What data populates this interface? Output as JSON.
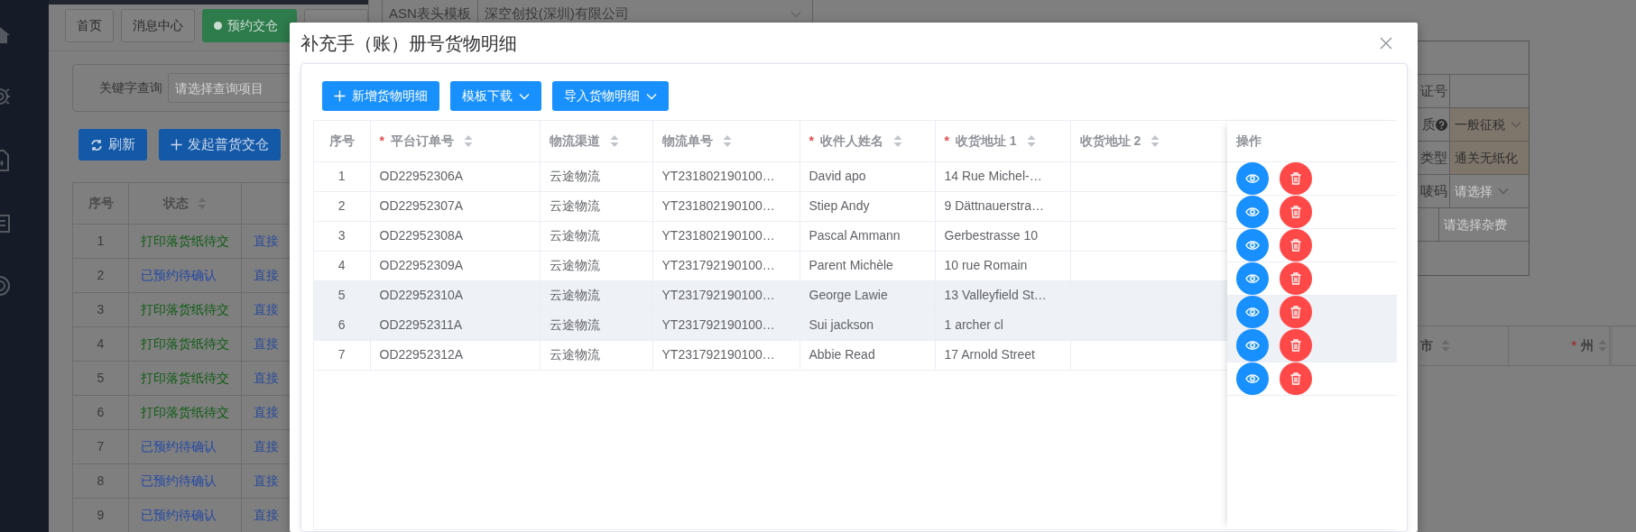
{
  "page_tabs": [
    {
      "label": "首页",
      "selected": false
    },
    {
      "label": "消息中心",
      "selected": false
    },
    {
      "label": "预约交仓",
      "selected": true
    },
    {
      "selected": false
    }
  ],
  "search": {
    "label": "关键字查询",
    "placeholder": "请选择查询项目"
  },
  "toolbar": [
    {
      "label": "刷新",
      "kind": "refresh"
    },
    {
      "label": "发起普货交仓",
      "kind": "create"
    }
  ],
  "list_table": {
    "columns": [
      {
        "label": "序号",
        "sortable": false
      },
      {
        "label": "状态",
        "sortable": true
      }
    ],
    "rows": [
      {
        "index": "1",
        "status": "打印落货纸待交",
        "color": "#0f5c14",
        "column_3": "直接"
      },
      {
        "index": "2",
        "status": "已预约待确认",
        "color": "#2549a6",
        "column_3": "直接"
      },
      {
        "index": "3",
        "status": "打印落货纸待交",
        "color": "#0f5c14",
        "column_3": "直接"
      },
      {
        "index": "4",
        "status": "打印落货纸待交",
        "color": "#0f5c14",
        "column_3": "直接"
      },
      {
        "index": "5",
        "status": "打印落货纸待交",
        "color": "#0f5c14",
        "column_3": "直接"
      },
      {
        "index": "6",
        "status": "打印落货纸待交",
        "color": "#0f5c14",
        "column_3": "直接"
      },
      {
        "index": "7",
        "status": "已预约待确认",
        "color": "#2549a6",
        "column_3": "直接"
      },
      {
        "index": "8",
        "status": "已预约待确认",
        "color": "#2549a6",
        "column_3": "直接"
      },
      {
        "index": "9",
        "status": "已预约待确认",
        "color": "#2549a6",
        "column_3": "直接"
      }
    ]
  },
  "drawer": {
    "template_label": "ASN表头模板",
    "template_value": "深空创投(深圳)有限公司",
    "form_rows": [
      {
        "kind": "blank"
      },
      {
        "kind": "field",
        "label": "证号"
      },
      {
        "kind": "field",
        "label": "质",
        "help": true,
        "value": "一般征税",
        "disabled": true,
        "dropdown": true
      },
      {
        "kind": "field",
        "label": "类型",
        "value": "通关无纸化",
        "disabled": true
      },
      {
        "kind": "field",
        "label": "唛码",
        "placeholder": "请选择",
        "dropdown": true
      },
      {
        "kind": "field",
        "placeholder": "请选择杂费"
      },
      {
        "kind": "blank"
      }
    ],
    "table_columns": [
      {
        "label": "市",
        "sortable": true
      },
      {
        "label": "州",
        "required_mark": "*",
        "sortable": true
      }
    ]
  },
  "modal": {
    "title": "补充手（账）册号货物明细",
    "buttons": [
      {
        "label": "新增货物明细",
        "kind": "add"
      },
      {
        "label": "模板下载",
        "kind": "dropdown"
      },
      {
        "label": "导入货物明细",
        "kind": "dropdown"
      }
    ],
    "columns": [
      {
        "label": "序号",
        "sortable": false
      },
      {
        "label": "平台订单号",
        "required_mark": "*",
        "sortable": true
      },
      {
        "label": "物流渠道",
        "sortable": true
      },
      {
        "label": "物流单号",
        "sortable": true
      },
      {
        "label": "收件人姓名",
        "required_mark": "*",
        "sortable": true
      },
      {
        "label": "收货地址 1",
        "required_mark": "*",
        "sortable": true
      },
      {
        "label": "收货地址 2",
        "sortable": true
      },
      {
        "label": "操作",
        "sortable": false
      }
    ],
    "rows": [
      {
        "index": "1",
        "order_no": "OD22952306A",
        "channel": "云途物流",
        "tracking_no": "YT231802190100…",
        "recipient": "David apo",
        "address_1": "14 Rue Michel-…",
        "highlighted": false
      },
      {
        "index": "2",
        "order_no": "OD22952307A",
        "channel": "云途物流",
        "tracking_no": "YT231802190100…",
        "recipient": "Stiep Andy",
        "address_1": "9 Dättnauerstra…",
        "highlighted": false
      },
      {
        "index": "3",
        "order_no": "OD22952308A",
        "channel": "云途物流",
        "tracking_no": "YT231802190100…",
        "recipient": "Pascal Ammann",
        "address_1": "Gerbestrasse 10",
        "highlighted": false
      },
      {
        "index": "4",
        "order_no": "OD22952309A",
        "channel": "云途物流",
        "tracking_no": "YT231792190100…",
        "recipient": "Parent Michèle",
        "address_1": "10 rue Romain",
        "highlighted": false
      },
      {
        "index": "5",
        "order_no": "OD22952310A",
        "channel": "云途物流",
        "tracking_no": "YT231792190100…",
        "recipient": "George Lawie",
        "address_1": "13 Valleyfield St…",
        "highlighted": true
      },
      {
        "index": "6",
        "order_no": "OD22952311A",
        "channel": "云途物流",
        "tracking_no": "YT231792190100…",
        "recipient": "Sui jackson",
        "address_1": "1 archer cl",
        "highlighted": true
      },
      {
        "index": "7",
        "order_no": "OD22952312A",
        "channel": "云途物流",
        "tracking_no": "YT231792190100…",
        "recipient": "Abbie Read",
        "address_1": "17 Arnold Street",
        "highlighted": false
      }
    ]
  }
}
